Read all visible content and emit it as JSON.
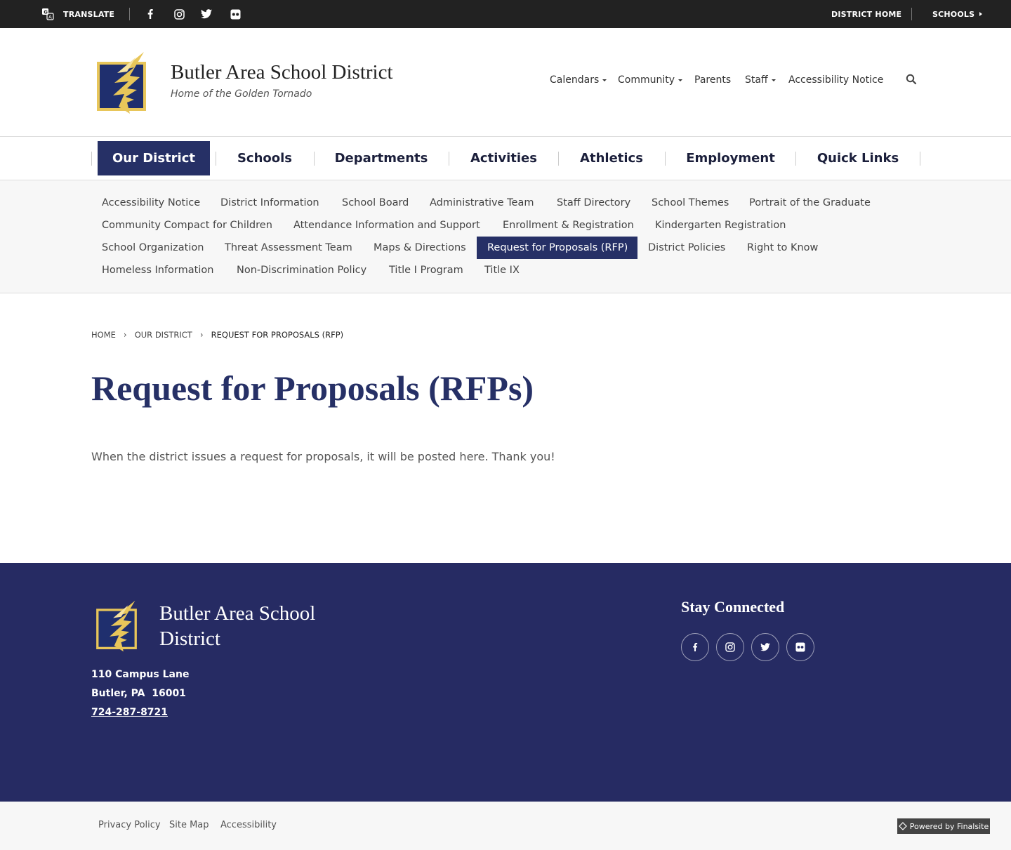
{
  "topbar": {
    "translate_label": "TRANSLATE",
    "district_home_label": "DISTRICT HOME",
    "schools_label": "SCHOOLS"
  },
  "header": {
    "title": "Butler Area School District",
    "subtitle": "Home of the Golden Tornado",
    "utility_nav": [
      "Calendars",
      "Community",
      "Parents",
      "Staff",
      "Accessibility Notice"
    ]
  },
  "main_nav": [
    "Our District",
    "Schools",
    "Departments",
    "Activities",
    "Athletics",
    "Employment",
    "Quick Links"
  ],
  "sub_nav": [
    "Accessibility Notice",
    "District Information",
    "School Board",
    "Administrative Team",
    "Staff Directory",
    "School Themes",
    "Portrait of the Graduate",
    "Community Compact for Children",
    "Attendance Information and Support",
    "Enrollment & Registration",
    "Kindergarten Registration",
    "School Organization",
    "Threat Assessment Team",
    "Maps & Directions",
    "Request for Proposals (RFP)",
    "District Policies",
    "Right to Know",
    "Homeless Information",
    "Non-Discrimination Policy",
    "Title I Program",
    "Title IX"
  ],
  "breadcrumb": [
    "HOME",
    "OUR DISTRICT",
    "REQUEST FOR PROPOSALS (RFP)"
  ],
  "page": {
    "title": "Request for Proposals (RFPs)",
    "body": "When the district issues a request for proposals, it will be posted here. Thank you!"
  },
  "footer": {
    "title": "Butler Area School District",
    "address_line1": "110 Campus Lane",
    "address_line2": "Butler, PA  16001",
    "phone": "724-287-8721",
    "stay_connected": "Stay Connected"
  },
  "bottom": {
    "links": [
      "Privacy Policy",
      "Site Map",
      "Accessibility"
    ],
    "powered_by": "Powered by Finalsite"
  },
  "icons": {
    "translate": "translate-icon",
    "social": [
      "facebook-icon",
      "instagram-icon",
      "twitter-icon",
      "flickr-icon"
    ],
    "search": "search-icon"
  },
  "colors": {
    "topbar": "#222222",
    "brand_navy": "#263066",
    "footer_bg": "#262b63",
    "gold": "#e8c65a"
  }
}
